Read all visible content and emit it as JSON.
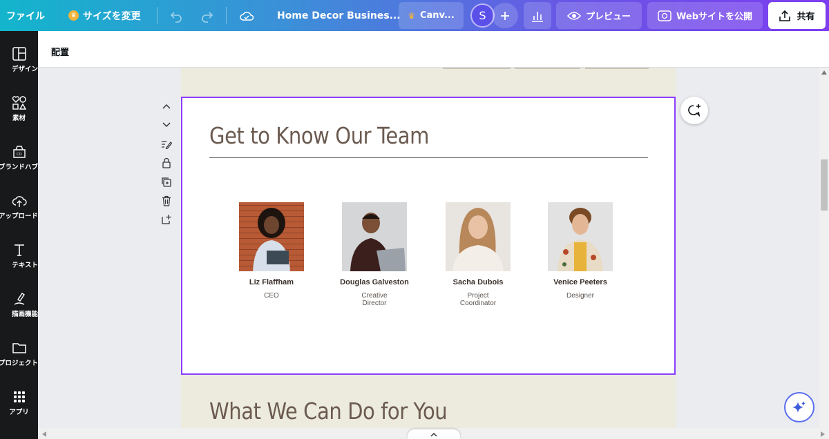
{
  "topbar": {
    "file_label": "ファイル",
    "resize_label": "サイズを変更",
    "doc_title": "Home Decor Busines...",
    "canva_label": "Canv...",
    "avatar_initial": "S",
    "preview_label": "プレビュー",
    "publish_label": "Webサイトを公開",
    "share_label": "共有"
  },
  "sidebar": {
    "items": [
      {
        "label": "デザイン",
        "icon": "layout-icon"
      },
      {
        "label": "素材",
        "icon": "elements-icon"
      },
      {
        "label": "ブランドハブ",
        "icon": "brand-icon"
      },
      {
        "label": "アップロード",
        "icon": "upload-icon"
      },
      {
        "label": "テキスト",
        "icon": "text-icon"
      },
      {
        "label": "描画機能",
        "icon": "draw-icon"
      },
      {
        "label": "プロジェクト",
        "icon": "folder-icon"
      },
      {
        "label": "アプリ",
        "icon": "apps-icon"
      }
    ]
  },
  "position_bar": {
    "label": "配置"
  },
  "team": {
    "title": "Get to Know Our Team",
    "members": [
      {
        "name": "Liz Flaffham",
        "role": "CEO"
      },
      {
        "name": "Douglas Galveston",
        "role": "Creative\nDirector"
      },
      {
        "name": "Sacha Dubois",
        "role": "Project\nCoordinator"
      },
      {
        "name": "Venice Peeters",
        "role": "Designer"
      }
    ]
  },
  "next_section": {
    "title": "What We Can Do for You"
  },
  "colors": {
    "accent": "#8b3dff",
    "section_bg": "#ecebdd",
    "heading": "#6b5a50"
  }
}
